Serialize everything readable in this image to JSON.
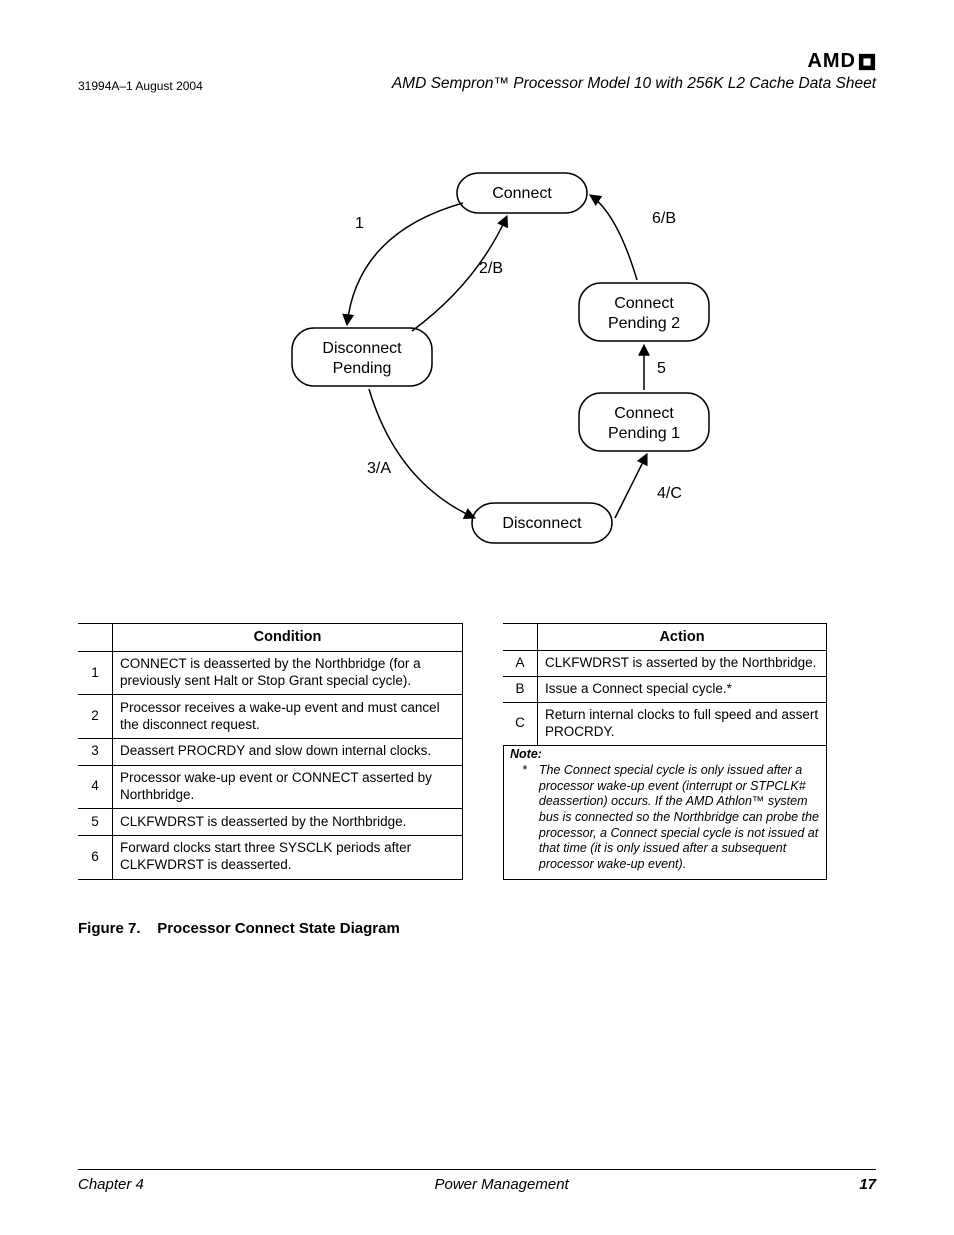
{
  "header": {
    "doc_id": "31994A–1 August 2004",
    "doc_title": "AMD Sempron™ Processor Model 10 with 256K L2 Cache Data Sheet",
    "logo_text": "AMD"
  },
  "diagram": {
    "nodes": {
      "connect": "Connect",
      "connect_pending_2_l1": "Connect",
      "connect_pending_2_l2": "Pending 2",
      "connect_pending_1_l1": "Connect",
      "connect_pending_1_l2": "Pending 1",
      "disconnect": "Disconnect",
      "disconnect_pending_l1": "Disconnect",
      "disconnect_pending_l2": "Pending"
    },
    "edge_labels": {
      "e1": "1",
      "e2b": "2/B",
      "e6b": "6/B",
      "e5": "5",
      "e4c": "4/C",
      "e3a": "3/A"
    }
  },
  "condition_table": {
    "header": "Condition",
    "rows": [
      {
        "k": "1",
        "v": "CONNECT is deasserted by the Northbridge (for a previously sent Halt or Stop Grant special cycle)."
      },
      {
        "k": "2",
        "v": "Processor receives a wake-up event and must cancel the disconnect request."
      },
      {
        "k": "3",
        "v": "Deassert PROCRDY and slow down internal clocks."
      },
      {
        "k": "4",
        "v": "Processor wake-up event or CONNECT asserted by Northbridge."
      },
      {
        "k": "5",
        "v": "CLKFWDRST is deasserted by the Northbridge."
      },
      {
        "k": "6",
        "v": "Forward clocks start three SYSCLK periods after CLKFWDRST is deasserted."
      }
    ]
  },
  "action_table": {
    "header": "Action",
    "rows": [
      {
        "k": "A",
        "v": "CLKFWDRST is asserted by the Northbridge."
      },
      {
        "k": "B",
        "v": "Issue a Connect special cycle.*"
      },
      {
        "k": "C",
        "v": "Return internal clocks to full speed and assert PROCRDY."
      }
    ],
    "note_label": "Note:",
    "note_ast": "*",
    "note_text": "The Connect special cycle is only issued after a processor wake-up event (interrupt or STPCLK# deassertion) occurs. If the AMD Athlon™ system bus is connected so the Northbridge can probe the processor, a Connect special cycle is not issued at that time (it is only issued after a subsequent processor wake-up event)."
  },
  "figure": {
    "label": "Figure 7.",
    "title": "Processor Connect State Diagram"
  },
  "footer": {
    "chapter": "Chapter 4",
    "section": "Power Management",
    "page": "17"
  }
}
